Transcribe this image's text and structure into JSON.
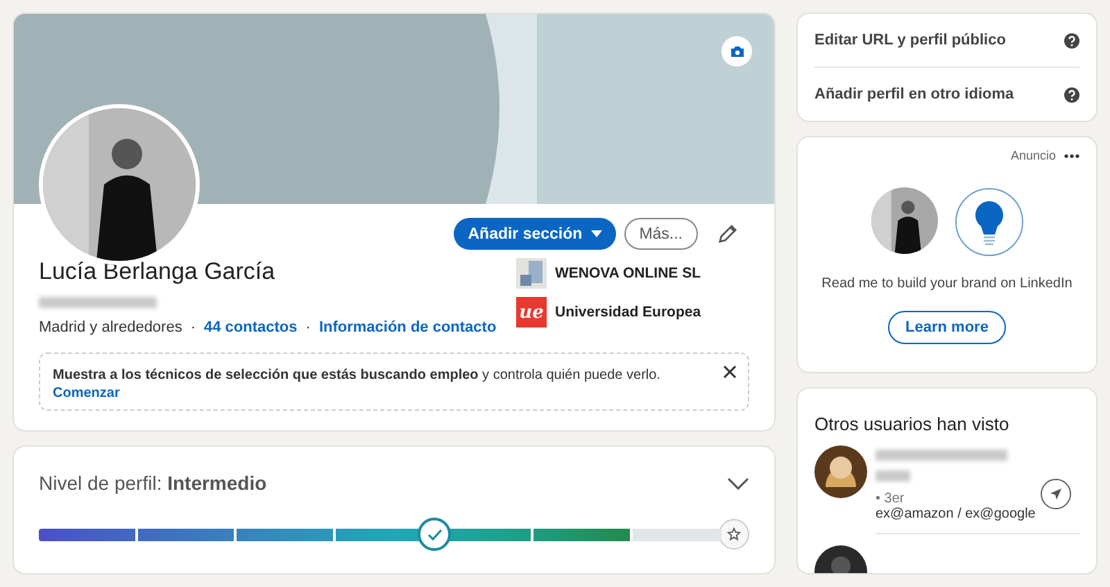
{
  "profile": {
    "name": "Lucía Berlanga García",
    "location": "Madrid y alrededores",
    "separator": "·",
    "contacts": "44 contactos",
    "contact_info": "Información de contacto",
    "add_section": "Añadir sección",
    "more": "Más...",
    "education": [
      {
        "kind": "company",
        "name": "WENOVA ONLINE SL"
      },
      {
        "kind": "university",
        "name": "Universidad Europea",
        "logo_text": "ue"
      }
    ],
    "notice": {
      "text": "**Muestra a los técnicos de selección que estás buscando empleo** y controla quién puede verlo.",
      "action": "Comenzar"
    }
  },
  "profile_level": {
    "label": "Nivel de perfil: **Intermedio**",
    "level": 0.87
  },
  "sidebar_links": [
    "Editar URL y perfil público",
    "Añadir perfil en otro idioma"
  ],
  "ad": {
    "label": "Anuncio",
    "text": "Read me to build your brand on LinkedIn",
    "button": "Learn more"
  },
  "viewers": {
    "title": "Otros usuarios han visto",
    "people": [
      {
        "degree": "• 3er",
        "headline": "ex@amazon / ex@google"
      }
    ]
  }
}
